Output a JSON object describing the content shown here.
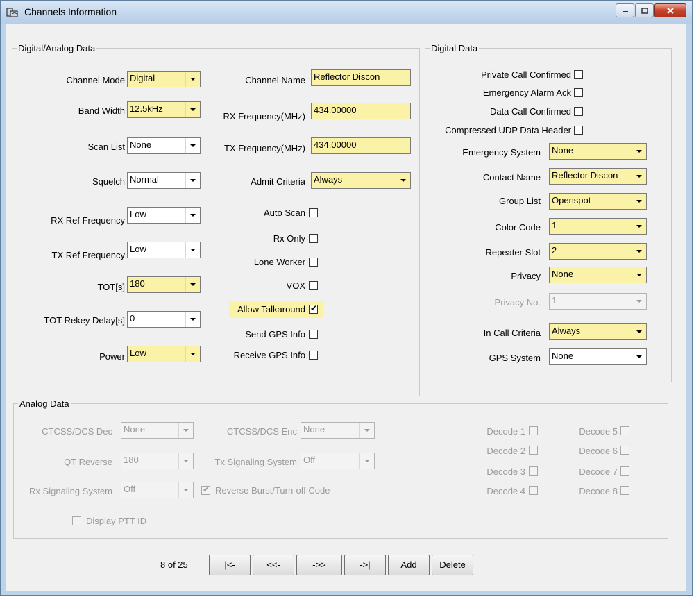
{
  "window": {
    "title": "Channels Information",
    "icon": "channels-app-icon"
  },
  "digital_analog": {
    "group_title": "Digital/Analog Data",
    "channel_mode": {
      "label": "Channel Mode",
      "value": "Digital"
    },
    "band_width": {
      "label": "Band Width",
      "value": "12.5kHz"
    },
    "scan_list": {
      "label": "Scan List",
      "value": "None"
    },
    "squelch": {
      "label": "Squelch",
      "value": "Normal"
    },
    "rx_ref_freq": {
      "label": "RX Ref Frequency",
      "value": "Low"
    },
    "tx_ref_freq": {
      "label": "TX Ref Frequency",
      "value": "Low"
    },
    "tot": {
      "label": "TOT[s]",
      "value": "180"
    },
    "tot_rekey": {
      "label": "TOT Rekey Delay[s]",
      "value": "0"
    },
    "power": {
      "label": "Power",
      "value": "Low"
    },
    "channel_name": {
      "label": "Channel Name",
      "value": "Reflector Discon"
    },
    "rx_frequency": {
      "label": "RX Frequency(MHz)",
      "value": "434.00000"
    },
    "tx_frequency": {
      "label": "TX Frequency(MHz)",
      "value": "434.00000"
    },
    "admit_criteria": {
      "label": "Admit Criteria",
      "value": "Always"
    },
    "auto_scan": {
      "label": "Auto Scan",
      "checked": false
    },
    "rx_only": {
      "label": "Rx Only",
      "checked": false
    },
    "lone_worker": {
      "label": "Lone Worker",
      "checked": false
    },
    "vox": {
      "label": "VOX",
      "checked": false
    },
    "allow_talkaround": {
      "label": "Allow Talkaround",
      "checked": true
    },
    "send_gps": {
      "label": "Send GPS Info",
      "checked": false
    },
    "receive_gps": {
      "label": "Receive GPS Info",
      "checked": false
    }
  },
  "digital": {
    "group_title": "Digital Data",
    "private_call": {
      "label": "Private Call Confirmed",
      "checked": false
    },
    "emergency_ack": {
      "label": "Emergency Alarm Ack",
      "checked": false
    },
    "data_call": {
      "label": "Data Call Confirmed",
      "checked": false
    },
    "compressed_udp": {
      "label": "Compressed UDP Data Header",
      "checked": false
    },
    "emergency_system": {
      "label": "Emergency System",
      "value": "None"
    },
    "contact_name": {
      "label": "Contact Name",
      "value": "Reflector Discon"
    },
    "group_list": {
      "label": "Group List",
      "value": "Openspot"
    },
    "color_code": {
      "label": "Color Code",
      "value": "1"
    },
    "repeater_slot": {
      "label": "Repeater Slot",
      "value": "2"
    },
    "privacy": {
      "label": "Privacy",
      "value": "None"
    },
    "privacy_no": {
      "label": "Privacy No.",
      "value": "1"
    },
    "in_call_criteria": {
      "label": "In Call Criteria",
      "value": "Always"
    },
    "gps_system": {
      "label": "GPS System",
      "value": "None"
    }
  },
  "analog": {
    "group_title": "Analog Data",
    "ctcss_dec": {
      "label": "CTCSS/DCS Dec",
      "value": "None"
    },
    "qt_reverse": {
      "label": "QT Reverse",
      "value": "180"
    },
    "rx_signaling": {
      "label": "Rx Signaling System",
      "value": "Off"
    },
    "ctcss_enc": {
      "label": "CTCSS/DCS Enc",
      "value": "None"
    },
    "tx_signaling": {
      "label": "Tx Signaling System",
      "value": "Off"
    },
    "reverse_burst": {
      "label": "Reverse Burst/Turn-off Code",
      "checked": true
    },
    "display_ptt": {
      "label": "Display PTT ID",
      "checked": false
    },
    "decodes": [
      "Decode 1",
      "Decode 2",
      "Decode 3",
      "Decode 4",
      "Decode 5",
      "Decode 6",
      "Decode 7",
      "Decode 8"
    ]
  },
  "nav": {
    "position": "8 of 25",
    "first": "|<-",
    "prev": "<<-",
    "next": "->>",
    "last": "->|",
    "add": "Add",
    "delete": "Delete"
  },
  "colors": {
    "highlight": "#faf2a6",
    "window_frame": "#bcd3ea",
    "close_button": "#c7442c"
  }
}
